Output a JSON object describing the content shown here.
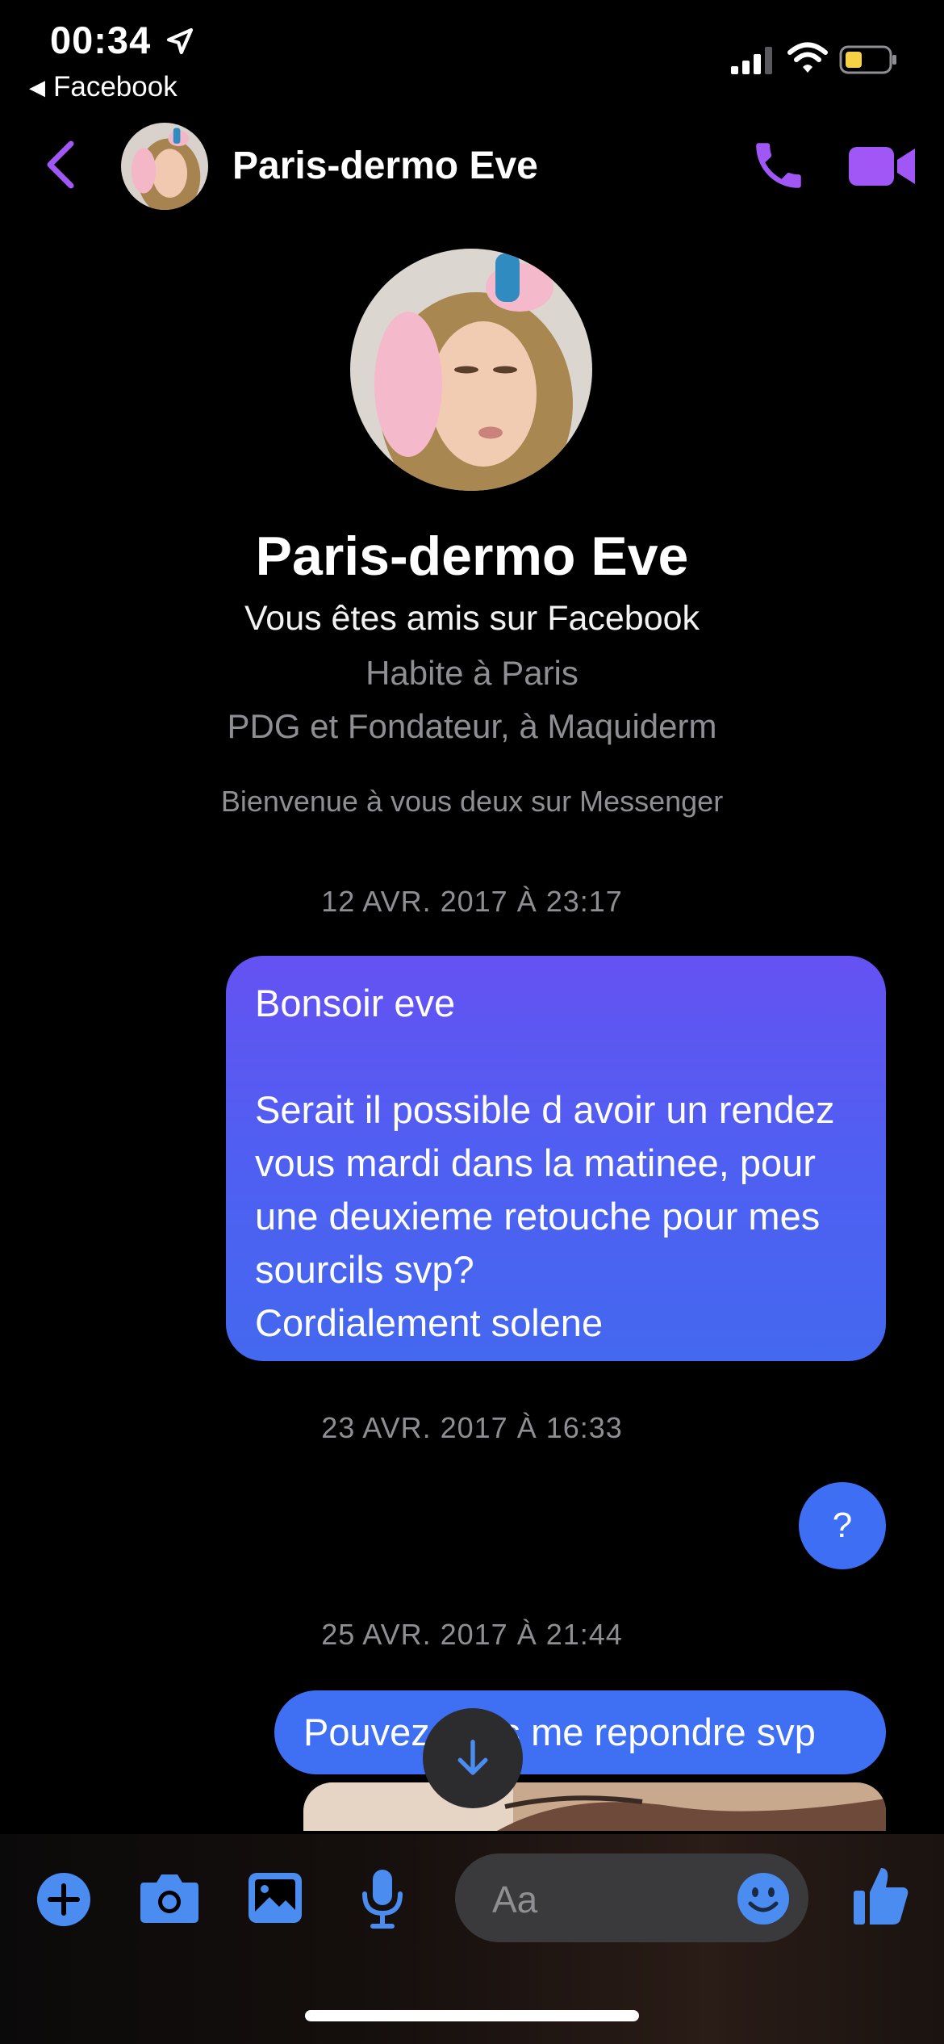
{
  "status_bar": {
    "time": "00:34",
    "back_app": "Facebook"
  },
  "header": {
    "contact_name": "Paris-dermo Eve"
  },
  "profile": {
    "name": "Paris-dermo Eve",
    "friendship": "Vous êtes amis sur Facebook",
    "lives": "Habite à Paris",
    "work": "PDG et Fondateur, à Maquiderm",
    "welcome": "Bienvenue à vous deux sur Messenger"
  },
  "conversation": {
    "timestamp1": "12 AVR. 2017 À 23:17",
    "message1": "Bonsoir eve\n\nSerait il possible d avoir un rendez vous mardi dans la matinee, pour une deuxieme retouche pour mes sourcils svp?\nCordialement solene",
    "timestamp2": "23 AVR. 2017 À 16:33",
    "message2": "?",
    "timestamp3": "25 AVR. 2017 À 21:44",
    "message3": "Pouvez vous me repondre svp"
  },
  "composer": {
    "placeholder": "Aa"
  },
  "colors": {
    "accent": "#a057f5",
    "bubble": "#4f5ff2",
    "composer_icons": "#4a8cf0"
  },
  "icons": [
    "location-arrow-icon",
    "signal-icon",
    "wifi-icon",
    "battery-icon",
    "back-chevron-icon",
    "phone-icon",
    "video-camera-icon",
    "arrow-down-icon",
    "plus-icon",
    "camera-icon",
    "gallery-icon",
    "microphone-icon",
    "emoji-icon",
    "thumbs-up-icon"
  ]
}
